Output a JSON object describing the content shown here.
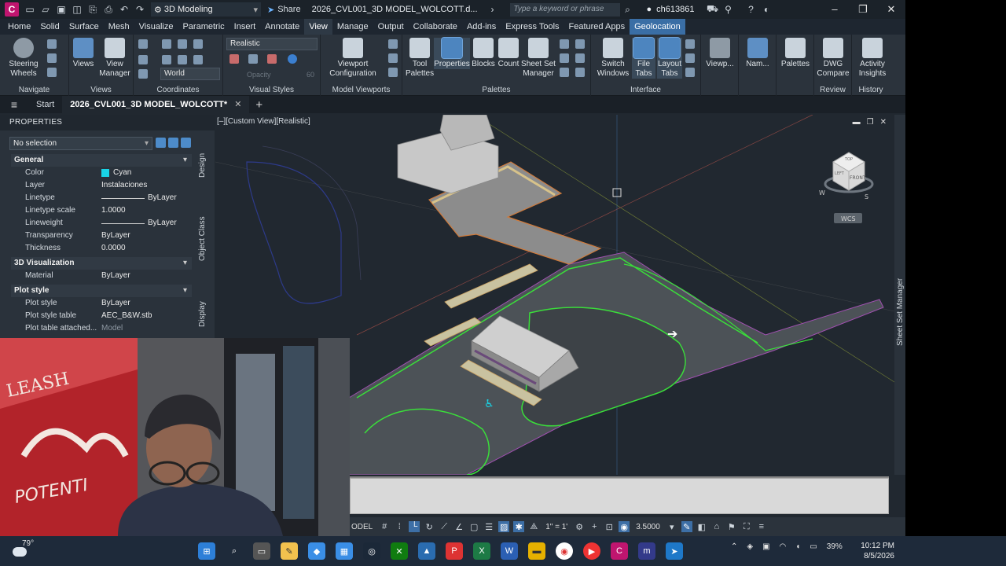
{
  "titlebar": {
    "app_letter": "C",
    "workspace": "3D Modeling",
    "share": "Share",
    "document": "2026_CVL001_3D MODEL_WOLCOTT.d...",
    "search_placeholder": "Type a keyword or phrase",
    "user": "ch613861"
  },
  "menu": {
    "tabs": [
      "Home",
      "Solid",
      "Surface",
      "Mesh",
      "Visualize",
      "Parametric",
      "Insert",
      "Annotate",
      "View",
      "Manage",
      "Output",
      "Collaborate",
      "Add-ins",
      "Express Tools",
      "Featured Apps",
      "Geolocation"
    ],
    "active": "View"
  },
  "ribbon": {
    "navigate": {
      "label": "Navigate",
      "steering": "Steering Wheels"
    },
    "views": {
      "label": "Views",
      "views_btn": "Views",
      "view_manager": "View Manager"
    },
    "coordinates": {
      "label": "Coordinates",
      "world": "World"
    },
    "visual_styles": {
      "label": "Visual Styles",
      "current": "Realistic",
      "opacity_label": "Opacity",
      "opacity_value": "60"
    },
    "model_viewports": {
      "label": "Model Viewports",
      "config": "Viewport Configuration"
    },
    "palettes": {
      "label": "Palettes",
      "tool_palettes": "Tool Palettes",
      "properties": "Properties",
      "blocks": "Blocks",
      "count": "Count",
      "ssm": "Sheet Set Manager"
    },
    "interface": {
      "label": "Interface",
      "switch_windows": "Switch Windows",
      "file_tabs": "File Tabs",
      "layout_tabs": "Layout Tabs"
    },
    "viewp": "Viewp...",
    "nam": "Nam...",
    "palettes2": "Palettes",
    "review": {
      "label": "Review",
      "dwg_compare": "DWG Compare"
    },
    "history": {
      "label": "History",
      "activity": "Activity Insights"
    }
  },
  "doctabs": {
    "start": "Start",
    "file": "2026_CVL001_3D MODEL_WOLCOTT*"
  },
  "properties": {
    "title": "PROPERTIES",
    "selection": "No selection",
    "general": {
      "label": "General",
      "color": {
        "k": "Color",
        "v": "Cyan"
      },
      "layer": {
        "k": "Layer",
        "v": "Instalaciones"
      },
      "linetype": {
        "k": "Linetype",
        "v": "ByLayer"
      },
      "ltscale": {
        "k": "Linetype scale",
        "v": "1.0000"
      },
      "lineweight": {
        "k": "Lineweight",
        "v": "ByLayer"
      },
      "transparency": {
        "k": "Transparency",
        "v": "ByLayer"
      },
      "thickness": {
        "k": "Thickness",
        "v": "0.0000"
      }
    },
    "viz": {
      "label": "3D Visualization",
      "material": {
        "k": "Material",
        "v": "ByLayer"
      }
    },
    "plot": {
      "label": "Plot style",
      "style": {
        "k": "Plot style",
        "v": "ByLayer"
      },
      "table": {
        "k": "Plot style table",
        "v": "AEC_B&W.stb"
      },
      "attached": {
        "k": "Plot table attached...",
        "v": "Model"
      }
    },
    "side_tabs": [
      "Design",
      "Object Class",
      "Display"
    ]
  },
  "viewport": {
    "label": "[–][Custom View][Realistic]",
    "wcs": "WCS",
    "cube_face": "FRONT",
    "cube_top": "TOP",
    "cube_left": "LEFT",
    "compass_w": "W",
    "compass_s": "S"
  },
  "right_palette": "Sheet Set Manager",
  "statusbar": {
    "model": "ODEL",
    "scale_1": "1\" = 1'",
    "scale_value": "3.5000"
  },
  "taskbar": {
    "temp": "79°",
    "battery": "39%",
    "time": "10:12 PM",
    "date": "8/5/2026"
  },
  "colors": {
    "accent": "#3a6ea5",
    "cyan": "#19d4e6",
    "green_curb": "#3adf3a"
  }
}
